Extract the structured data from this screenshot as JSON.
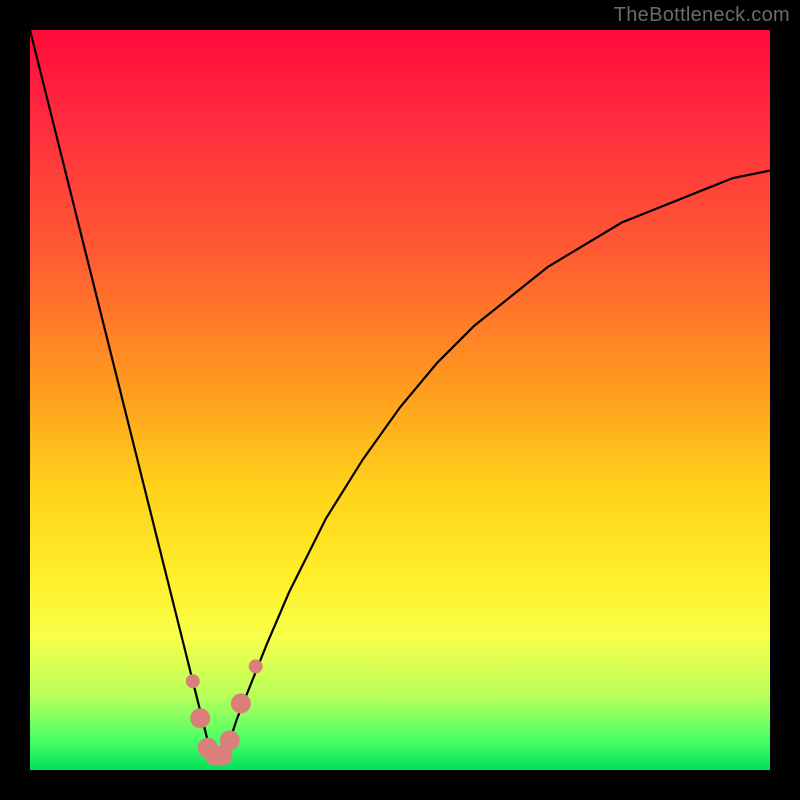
{
  "watermark": "TheBottleneck.com",
  "chart_data": {
    "type": "line",
    "title": "",
    "xlabel": "",
    "ylabel": "",
    "xlim": [
      0,
      100
    ],
    "ylim": [
      0,
      100
    ],
    "gradient_stops": [
      {
        "pos": 0,
        "color": "#ff0a3a"
      },
      {
        "pos": 30,
        "color": "#ff5a33"
      },
      {
        "pos": 62,
        "color": "#ffd21a"
      },
      {
        "pos": 82,
        "color": "#f8ff4a"
      },
      {
        "pos": 100,
        "color": "#00e05a"
      }
    ],
    "series": [
      {
        "name": "bottleneck-curve",
        "color": "#000000",
        "x": [
          0,
          2,
          4,
          6,
          8,
          10,
          12,
          14,
          16,
          18,
          20,
          22,
          23,
          24,
          25,
          26,
          27,
          28,
          30,
          32,
          35,
          40,
          45,
          50,
          55,
          60,
          65,
          70,
          75,
          80,
          85,
          90,
          95,
          100
        ],
        "y": [
          100,
          92,
          84,
          76,
          68,
          60,
          52,
          44,
          36,
          28,
          20,
          12,
          8,
          4,
          2,
          2,
          4,
          7,
          12,
          17,
          24,
          34,
          42,
          49,
          55,
          60,
          64,
          68,
          71,
          74,
          76,
          78,
          80,
          81
        ]
      }
    ],
    "markers": {
      "name": "bottom-cluster",
      "color": "#d9807b",
      "radius_major": 10,
      "radius_minor": 7,
      "points": [
        {
          "x": 22.0,
          "y": 12
        },
        {
          "x": 23.0,
          "y": 7
        },
        {
          "x": 24.0,
          "y": 3
        },
        {
          "x": 25.0,
          "y": 2
        },
        {
          "x": 26.0,
          "y": 2
        },
        {
          "x": 27.0,
          "y": 4
        },
        {
          "x": 28.5,
          "y": 9
        },
        {
          "x": 30.5,
          "y": 14
        }
      ]
    }
  }
}
